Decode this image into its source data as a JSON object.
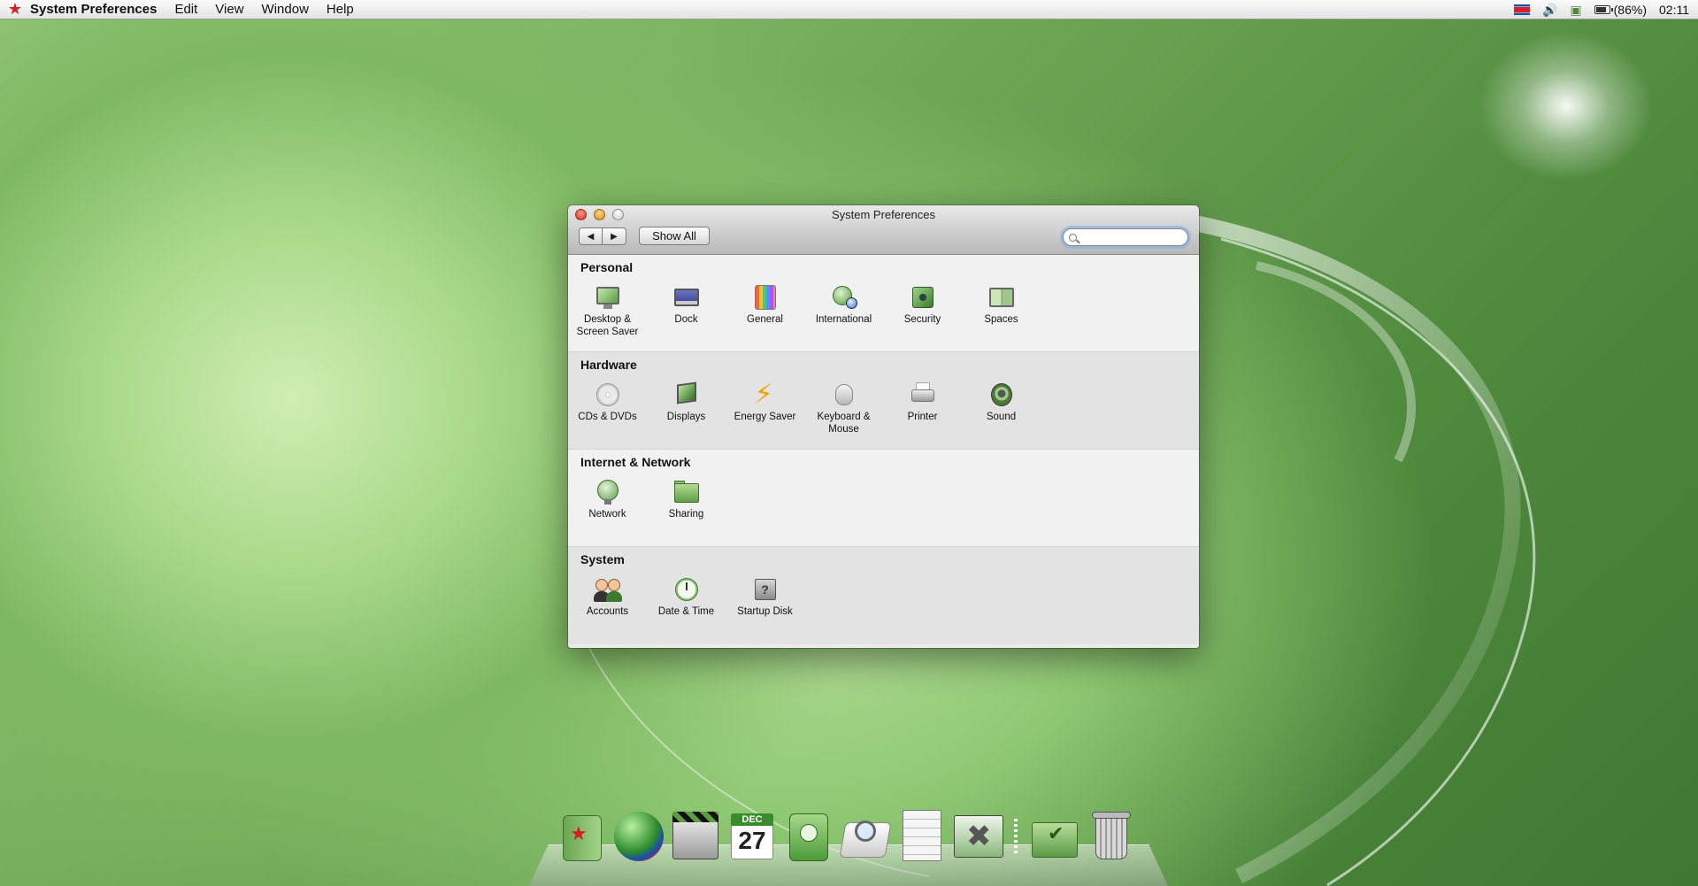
{
  "menubar": {
    "app_name": "System Preferences",
    "menus": [
      "Edit",
      "View",
      "Window",
      "Help"
    ],
    "battery": "(86%)",
    "battery_fraction": 0.86,
    "clock": "02:11"
  },
  "window": {
    "title": "System Preferences",
    "show_all": "Show All",
    "search_placeholder": ""
  },
  "sections": [
    {
      "title": "Personal",
      "panes": [
        {
          "label": "Desktop & Screen Saver",
          "icon": "desktop-icon"
        },
        {
          "label": "Dock",
          "icon": "dock-icon"
        },
        {
          "label": "General",
          "icon": "general-icon"
        },
        {
          "label": "International",
          "icon": "international-icon"
        },
        {
          "label": "Security",
          "icon": "security-icon"
        },
        {
          "label": "Spaces",
          "icon": "spaces-icon"
        }
      ]
    },
    {
      "title": "Hardware",
      "panes": [
        {
          "label": "CDs & DVDs",
          "icon": "cd-icon"
        },
        {
          "label": "Displays",
          "icon": "displays-icon"
        },
        {
          "label": "Energy Saver",
          "icon": "energy-icon"
        },
        {
          "label": "Keyboard & Mouse",
          "icon": "mouse-icon"
        },
        {
          "label": "Printer",
          "icon": "printer-icon"
        },
        {
          "label": "Sound",
          "icon": "sound-icon"
        }
      ]
    },
    {
      "title": "Internet & Network",
      "panes": [
        {
          "label": "Network",
          "icon": "network-icon"
        },
        {
          "label": "Sharing",
          "icon": "sharing-icon"
        }
      ]
    },
    {
      "title": "System",
      "panes": [
        {
          "label": "Accounts",
          "icon": "accounts-icon"
        },
        {
          "label": "Date & Time",
          "icon": "clock-icon"
        },
        {
          "label": "Startup Disk",
          "icon": "startup-disk-icon"
        }
      ]
    }
  ],
  "dock": {
    "calendar_month": "DEC",
    "calendar_day": "27"
  },
  "colors": {
    "accent_green": "#5a9e45",
    "close_red": "#d42a1c",
    "minimize_orange": "#d68a10"
  }
}
